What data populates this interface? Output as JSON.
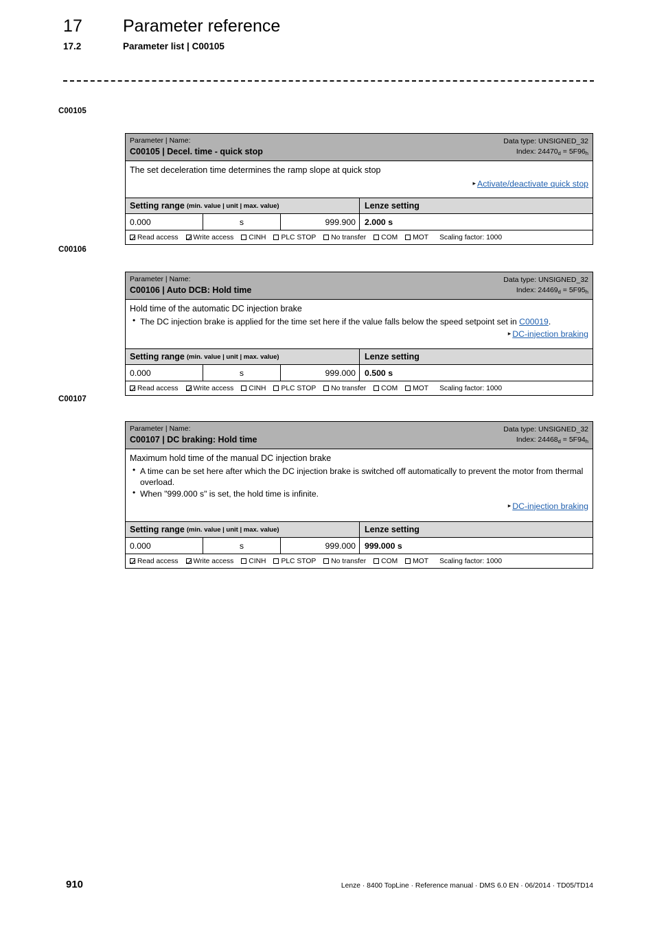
{
  "header": {
    "chapter_number": "17",
    "chapter_title": "Parameter reference",
    "section_number": "17.2",
    "section_title": "Parameter list | C00105"
  },
  "common": {
    "param_name_label": "Parameter | Name:",
    "data_type_label": "Data type: UNSIGNED_32",
    "index_label": "Index:",
    "index_sub_dec": "d",
    "index_sub_hex": "h",
    "setting_range_title": "Setting range",
    "setting_range_sub": "(min. value | unit | max. value)",
    "lenze_setting_title": "Lenze setting",
    "flags": [
      {
        "label": "Read access",
        "checked": true
      },
      {
        "label": "Write access",
        "checked": true
      },
      {
        "label": "CINH",
        "checked": false
      },
      {
        "label": "PLC STOP",
        "checked": false
      },
      {
        "label": "No transfer",
        "checked": false
      },
      {
        "label": "COM",
        "checked": false
      },
      {
        "label": "MOT",
        "checked": false
      }
    ],
    "scaling_factor": "Scaling factor: 1000"
  },
  "parameters": [
    {
      "margin_label": "C00105",
      "code": "C00105",
      "name": "C00105 | Decel. time - quick stop",
      "index_dec": "24470",
      "index_hex": "5F96",
      "description": "The set deceleration time determines the ramp slope at quick stop",
      "bullets": [],
      "xref": "Activate/deactivate quick stop",
      "min_value": "0.000",
      "unit": "s",
      "max_value": "999.900",
      "lenze_setting": "2.000 s"
    },
    {
      "margin_label": "C00106",
      "code": "C00106",
      "name": "C00106 | Auto DCB: Hold time",
      "index_dec": "24469",
      "index_hex": "5F95",
      "description": "Hold time of the automatic DC injection brake",
      "bullets": [
        "The DC injection brake is applied for the time set here if the value falls below the speed setpoint set in C00019."
      ],
      "bullet_link": "C00019",
      "xref": "DC-injection braking",
      "min_value": "0.000",
      "unit": "s",
      "max_value": "999.000",
      "lenze_setting": "0.500 s"
    },
    {
      "margin_label": "C00107",
      "code": "C00107",
      "name": "C00107 | DC braking: Hold time",
      "index_dec": "24468",
      "index_hex": "5F94",
      "description": "Maximum hold time of the manual DC injection brake",
      "bullets": [
        "A time can be set here after which the DC injection brake is switched off automatically to prevent the motor from thermal overload.",
        "When \"999.000 s\" is set, the hold time is infinite."
      ],
      "xref": "DC-injection braking",
      "min_value": "0.000",
      "unit": "s",
      "max_value": "999.000",
      "lenze_setting": "999.000 s"
    }
  ],
  "footer": {
    "page_number": "910",
    "text": "Lenze · 8400 TopLine · Reference manual · DMS 6.0 EN · 06/2014 · TD05/TD14"
  }
}
